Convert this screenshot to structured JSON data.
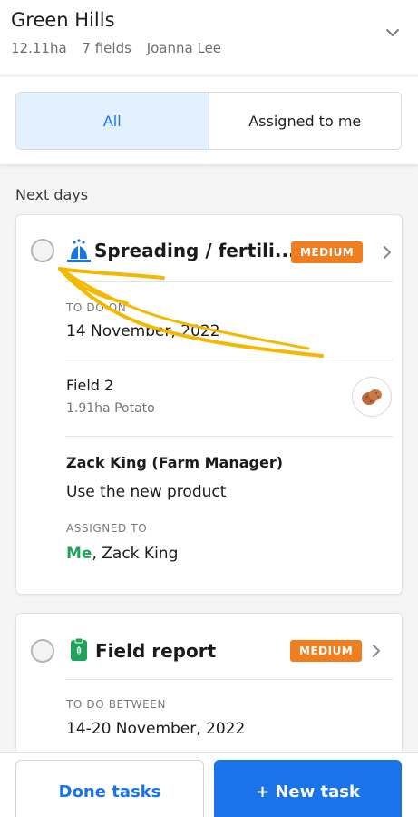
{
  "header": {
    "farm_name": "Green Hills",
    "area": "12.11ha",
    "fields_count": "7 fields",
    "owner": "Joanna Lee"
  },
  "filters": {
    "all_label": "All",
    "assigned_label": "Assigned to me",
    "selected": "All"
  },
  "section_label": "Next days",
  "tasks": [
    {
      "title": "Spreading / fertili...",
      "priority": "MEDIUM",
      "date_label": "TO DO ON",
      "date": "14 November, 2022",
      "field_name": "Field 2",
      "field_detail": "1.91ha Potato",
      "crop_icon": "potato-icon",
      "note_author": "Zack King (Farm Manager)",
      "note_body": "Use the new product",
      "assigned_label": "ASSIGNED TO",
      "assigned_me": "Me",
      "assigned_rest": ", Zack King"
    },
    {
      "title": "Field report",
      "priority": "MEDIUM",
      "date_label": "TO DO BETWEEN",
      "date": "14-20 November, 2022"
    }
  ],
  "actions": {
    "done_label": "Done tasks",
    "new_label": "+ New task"
  },
  "colors": {
    "accent": "#1a73e8",
    "priority_medium": "#f07e1e",
    "me_green": "#1fa35b",
    "annotation_arrow": "#f5b800"
  }
}
